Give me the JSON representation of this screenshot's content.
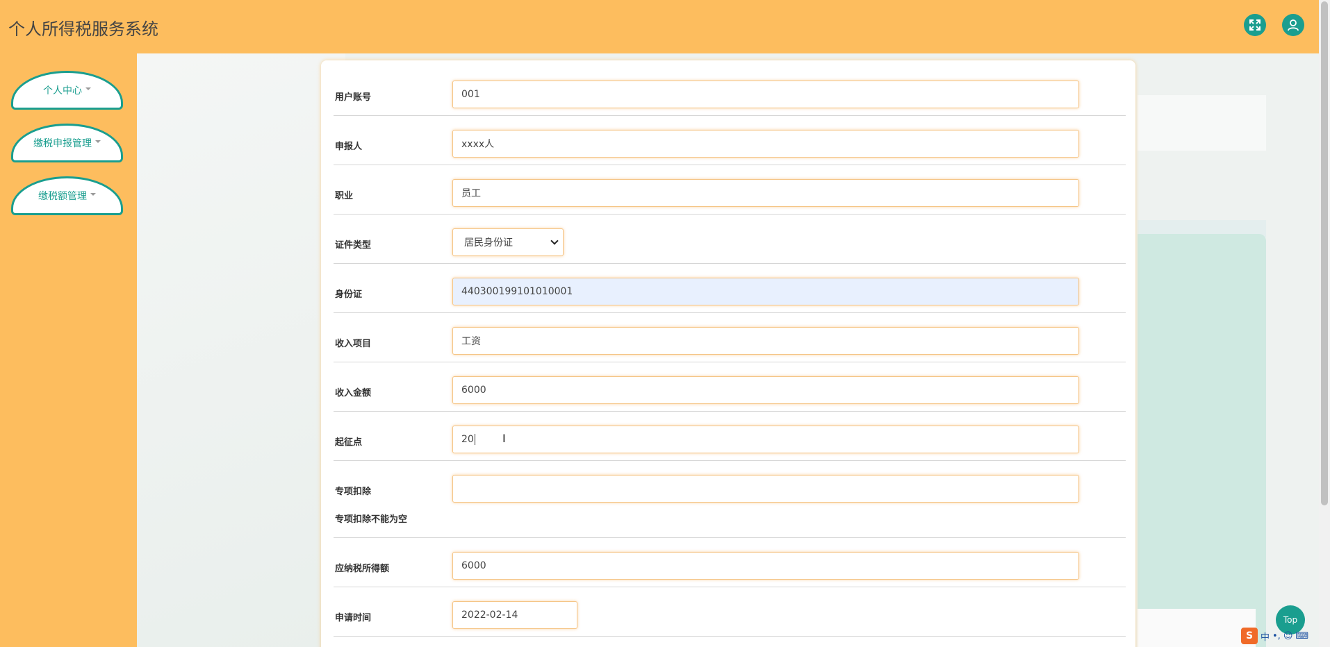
{
  "header": {
    "title": "个人所得税服务系统"
  },
  "icons": {
    "fullscreen": "fullscreen-icon",
    "user": "user-icon"
  },
  "sidebar": {
    "items": [
      {
        "label": "个人中心"
      },
      {
        "label": "缴税申报管理"
      },
      {
        "label": "缴税额管理"
      }
    ]
  },
  "form": {
    "fields": [
      {
        "label": "用户账号",
        "value": "001"
      },
      {
        "label": "申报人",
        "value": "xxxx人"
      },
      {
        "label": "职业",
        "value": "员工"
      },
      {
        "label": "证件类型",
        "value": "居民身份证"
      },
      {
        "label": "身份证",
        "value": "440300199101010001"
      },
      {
        "label": "收入项目",
        "value": "工资"
      },
      {
        "label": "收入金额",
        "value": "6000"
      },
      {
        "label": "起征点",
        "value": "20"
      },
      {
        "label": "专项扣除",
        "value": "",
        "error": "专项扣除不能为空"
      },
      {
        "label": "应纳税所得额",
        "value": "6000"
      },
      {
        "label": "申请时间",
        "value": "2022-02-14"
      }
    ]
  },
  "top_button": "Top",
  "ime": {
    "logo": "S",
    "mode": "中",
    "punct": "•,"
  },
  "colors": {
    "accent": "#1a9e8f",
    "header_bg": "#fdbd5e",
    "field_border": "#f5c586"
  }
}
